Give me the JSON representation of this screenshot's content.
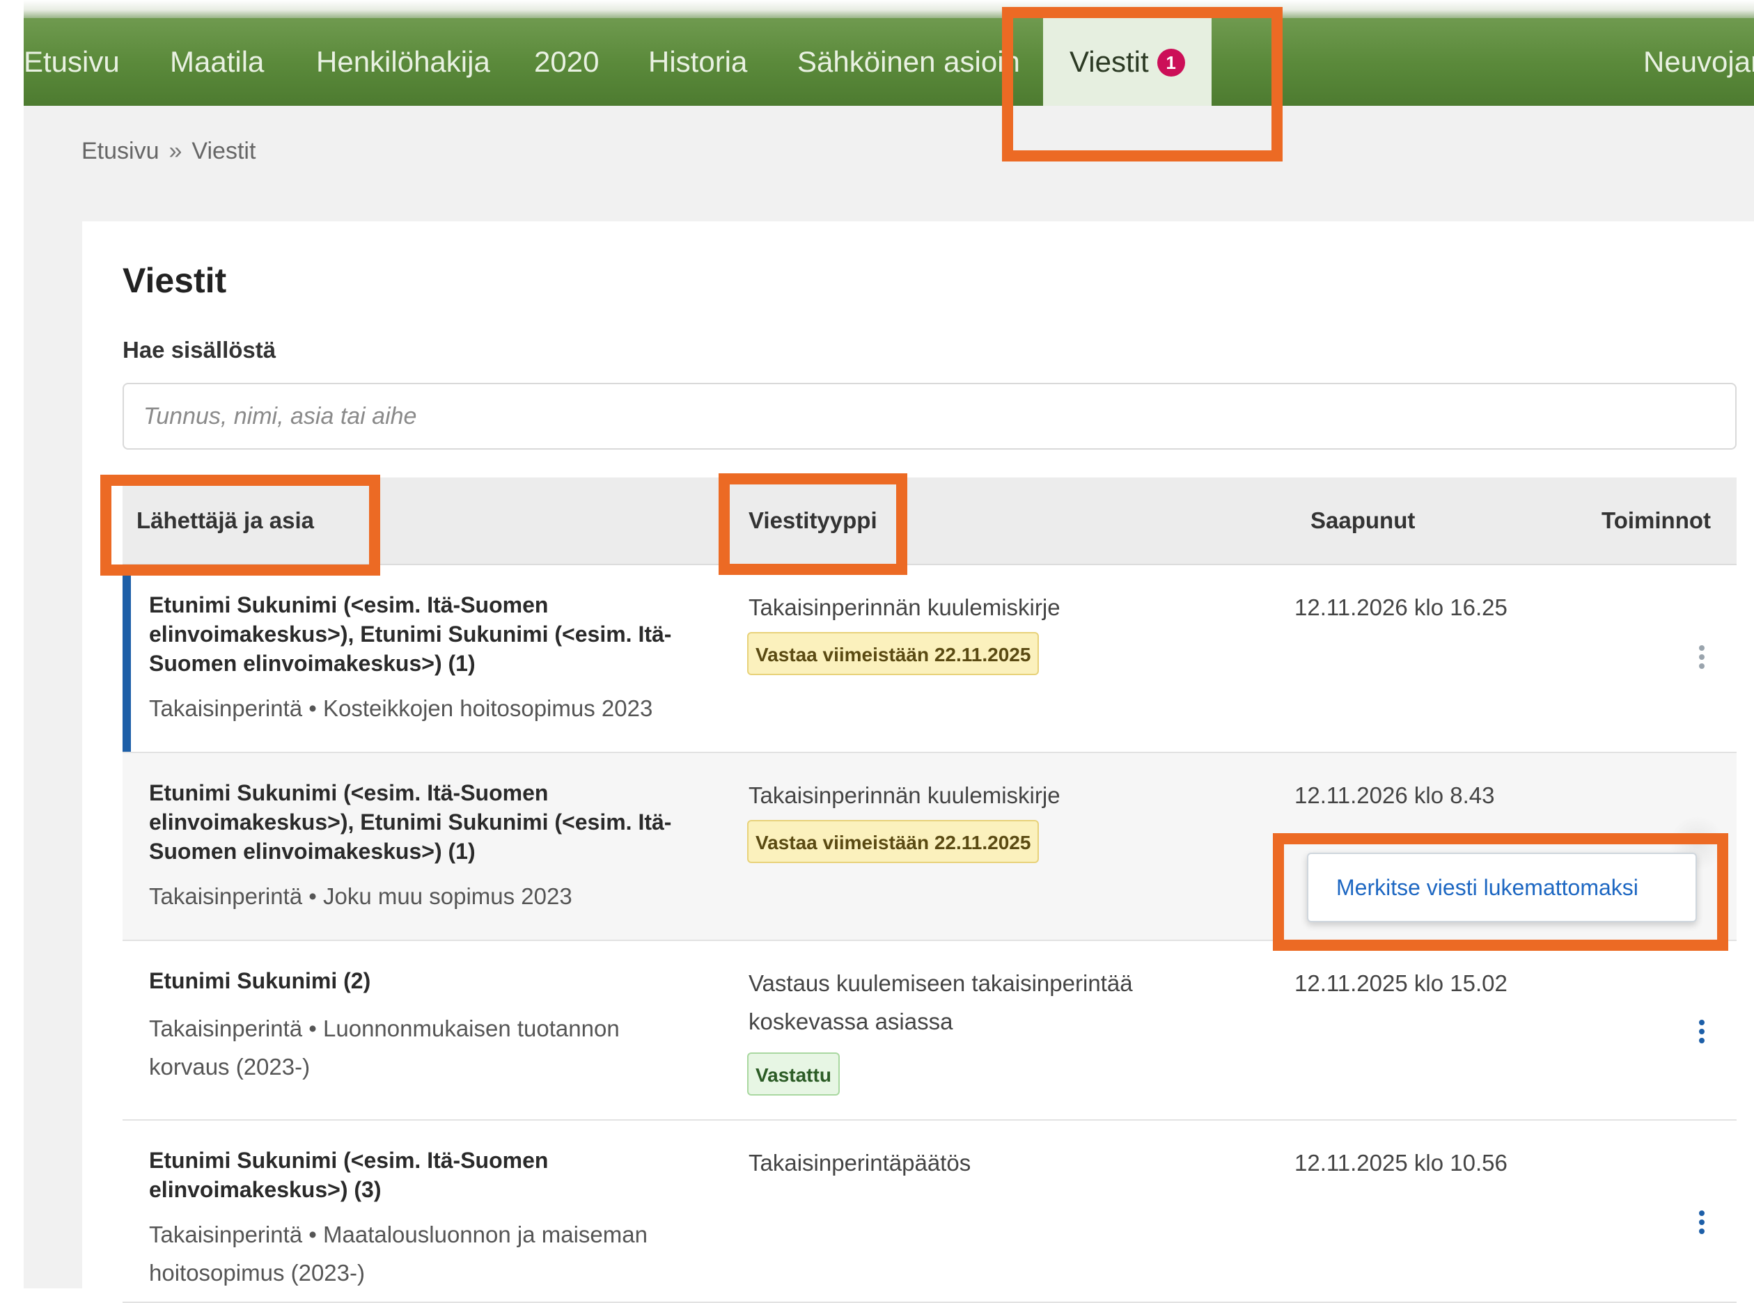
{
  "nav": {
    "items": [
      {
        "label": "Etusivu"
      },
      {
        "label": "Maatila"
      },
      {
        "label": "Henkilöhakija"
      },
      {
        "label": "2020"
      },
      {
        "label": "Historia"
      },
      {
        "label": "Sähköinen asioin"
      },
      {
        "label": "Viestit",
        "badge": "1"
      },
      {
        "label": "Neuvojan"
      }
    ],
    "active": "Viestit",
    "badge_color": "#cc0f58",
    "bar_color": "#5b8a3b"
  },
  "breadcrumb": {
    "home": "Etusivu",
    "separator": "»",
    "current": "Viestit"
  },
  "page": {
    "title": "Viestit"
  },
  "search": {
    "label": "Hae sisällöstä",
    "placeholder": "Tunnus, nimi, asia tai aihe",
    "value": ""
  },
  "table": {
    "headers": {
      "sender": "Lähettäjä ja asia",
      "type": "Viestityyppi",
      "arrived": "Saapunut",
      "actions": "Toiminnot"
    },
    "rows": [
      {
        "sender": "Etunimi Sukunimi (<esim. Itä-Suomen elinvoimakeskus>), Etunimi Sukunimi (<esim. Itä-Suomen elinvoimakeskus>) (1)",
        "topic": "Takaisinperintä • Kosteikkojen hoitosopimus 2023",
        "type": "Takaisinperinnän kuulemiskirje",
        "tag": "Vastaa viimeistään 22.11.2025",
        "arrived": "12.11.2026 klo 16.25",
        "unread": true
      },
      {
        "sender": "Etunimi Sukunimi (<esim. Itä-Suomen elinvoimakeskus>), Etunimi Sukunimi (<esim. Itä-Suomen elinvoimakeskus>) (1)",
        "topic": "Takaisinperintä • Joku muu sopimus 2023",
        "type": "Takaisinperinnän kuulemiskirje",
        "tag": "Vastaa viimeistään 22.11.2025",
        "arrived": "12.11.2026 klo 8.43",
        "unread": false
      },
      {
        "sender": "Etunimi Sukunimi (2)",
        "topic": "Takaisinperintä • Luonnonmukaisen tuotannon korvaus (2023-)",
        "type": "Vastaus kuulemiseen takaisinperintää koskevassa asiassa",
        "tag": "Vastattu",
        "arrived": "12.11.2025 klo 15.02",
        "unread": false
      },
      {
        "sender": "Etunimi Sukunimi (<esim. Itä-Suomen elinvoimakeskus>) (3)",
        "topic": "Takaisinperintä • Maatalousluonnon ja maiseman hoitosopimus (2023-)",
        "type": "Takaisinperintäpäätös",
        "tag": "",
        "arrived": "12.11.2025 klo 10.56",
        "unread": false
      }
    ]
  },
  "context_menu": {
    "item": "Merkitse viesti lukemattomaksi"
  },
  "colors": {
    "highlight": "#ec6a24",
    "unread_bar": "#1d5fa8",
    "link": "#1d67c2"
  }
}
